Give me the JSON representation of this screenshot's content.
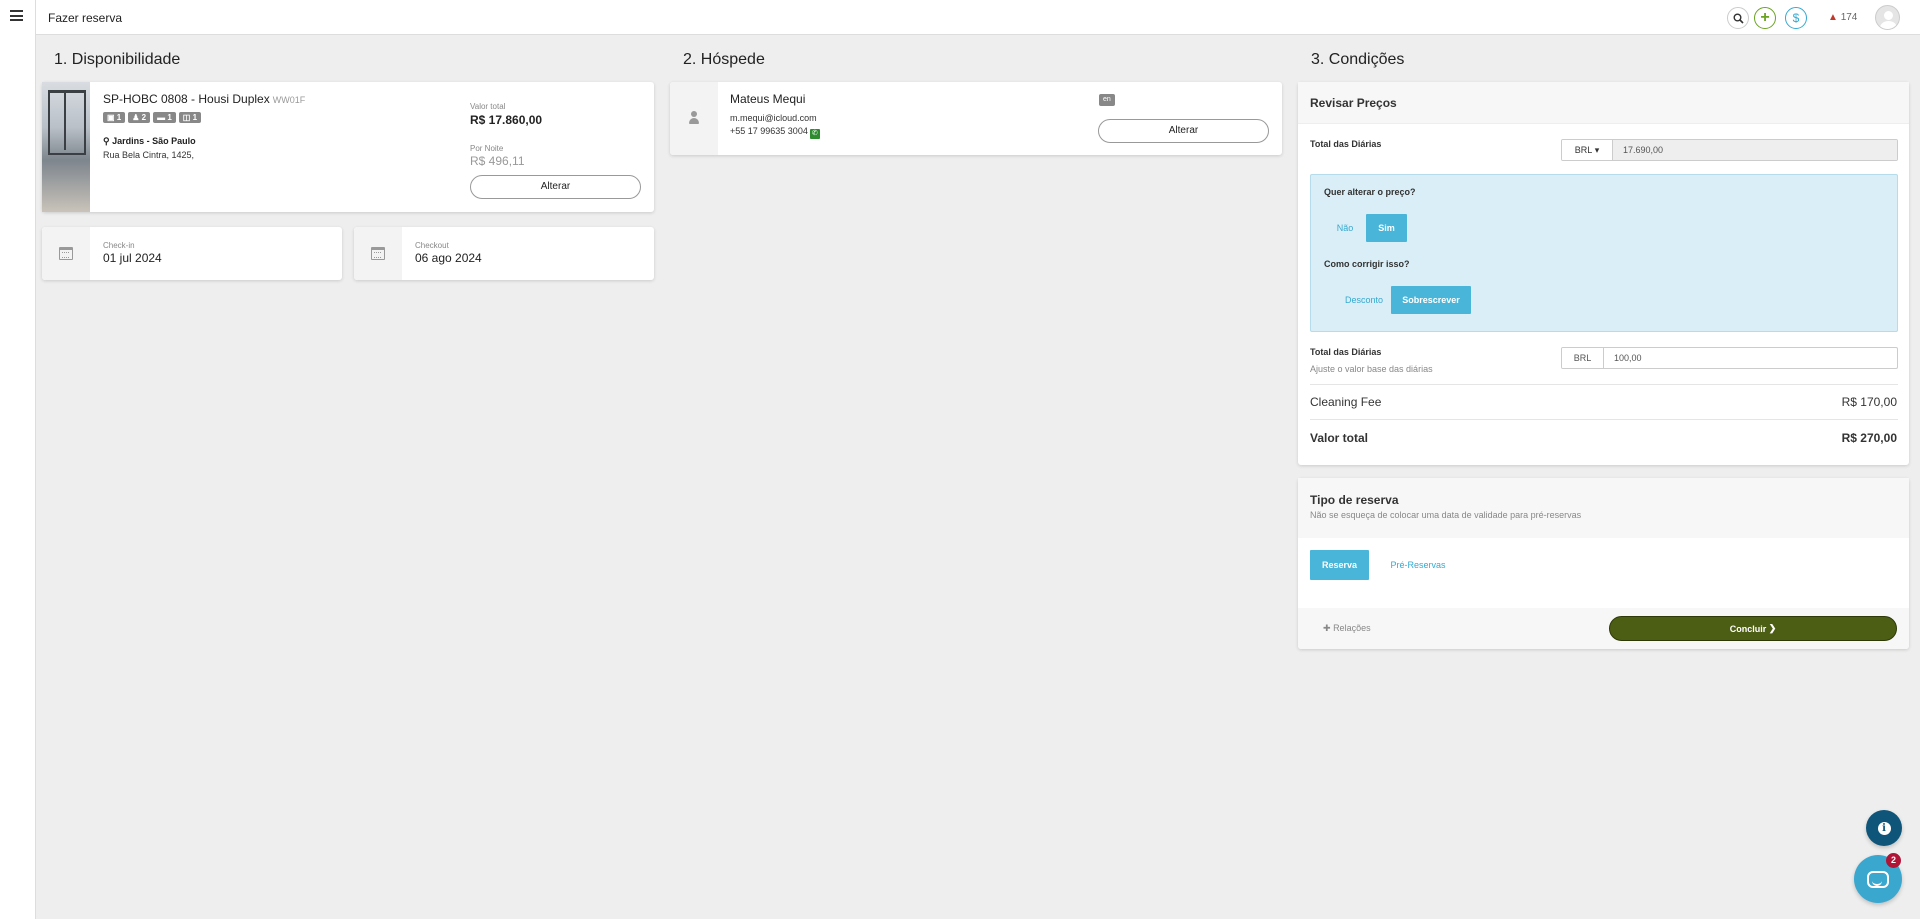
{
  "topbar": {
    "title": "Fazer reserva",
    "alerts_count": "174"
  },
  "sections": {
    "availability": "1. Disponibilidade",
    "guest": "2. Hóspede",
    "conditions": "3. Condições"
  },
  "property": {
    "name": "SP-HOBC 0808 - Housi Duplex",
    "code": "WW01F",
    "badges": [
      "1",
      "2",
      "1",
      "1"
    ],
    "location": "Jardins - São Paulo",
    "address": "Rua Bela Cintra, 1425,",
    "total_label": "Valor total",
    "total_value": "R$ 17.860,00",
    "night_label": "Por Noite",
    "night_value": "R$ 496,11",
    "change_button": "Alterar"
  },
  "dates": {
    "checkin_label": "Check-in",
    "checkin_value": "01 jul 2024",
    "checkout_label": "Checkout",
    "checkout_value": "06 ago 2024"
  },
  "guest": {
    "name": "Mateus Mequi",
    "email": "m.mequi@icloud.com",
    "phone": "+55 17 99635 3004",
    "language": "en",
    "change_button": "Alterar"
  },
  "conditions": {
    "panel_title": "Revisar Preços",
    "daily_total_label": "Total das Diárias",
    "currency": "BRL",
    "daily_total_value": "17.690,00",
    "question_change": "Quer alterar o preço?",
    "option_no": "Não",
    "option_yes": "Sim",
    "question_fix": "Como corrigir isso?",
    "option_discount": "Desconto",
    "option_override": "Sobrescrever",
    "adjust_label": "Total das Diárias",
    "adjust_hint": "Ajuste o valor base das diárias",
    "adjust_currency": "BRL",
    "adjust_value": "100,00",
    "cleaning_label": "Cleaning Fee",
    "cleaning_value": "R$ 170,00",
    "total_label": "Valor total",
    "total_value": "R$ 270,00"
  },
  "reservation_type": {
    "title": "Tipo de reserva",
    "subtitle": "Não se esqueça de colocar uma data de validade para pré-reservas",
    "option_reserva": "Reserva",
    "option_pre": "Pré-Reservas",
    "relations": "Relações",
    "conclude": "Concluir"
  },
  "chat": {
    "badge": "2"
  },
  "colors": {
    "accent_blue": "#49b5d9",
    "conclude_green": "#4c5e14",
    "add_green": "#6aa320"
  }
}
